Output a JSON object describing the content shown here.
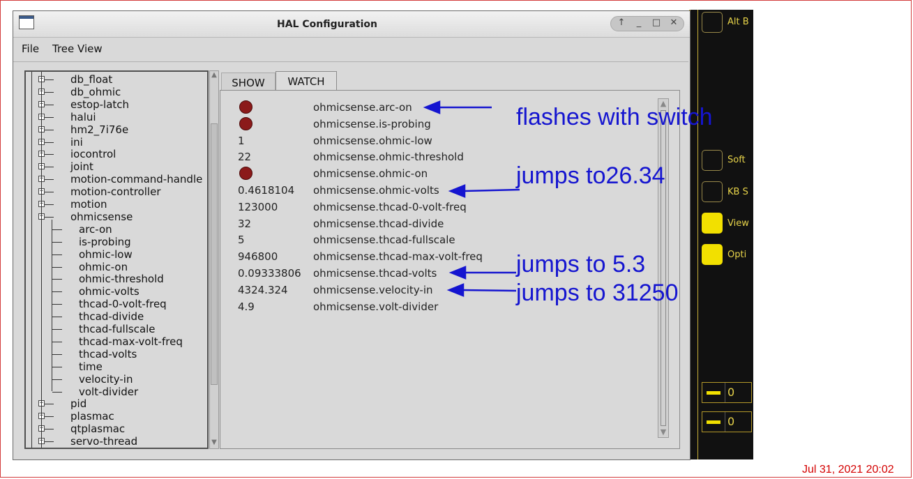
{
  "window": {
    "title": "HAL Configuration",
    "controls": [
      "↑",
      "_",
      "□",
      "✕"
    ]
  },
  "menu": {
    "file": "File",
    "tree_view": "Tree View"
  },
  "tree": {
    "items": [
      {
        "label": "db_float",
        "level": 0,
        "expandable": true
      },
      {
        "label": "db_ohmic",
        "level": 0,
        "expandable": true
      },
      {
        "label": "estop-latch",
        "level": 0,
        "expandable": true
      },
      {
        "label": "halui",
        "level": 0,
        "expandable": true
      },
      {
        "label": "hm2_7i76e",
        "level": 0,
        "expandable": true
      },
      {
        "label": "ini",
        "level": 0,
        "expandable": true
      },
      {
        "label": "iocontrol",
        "level": 0,
        "expandable": true
      },
      {
        "label": "joint",
        "level": 0,
        "expandable": true
      },
      {
        "label": "motion-command-handle",
        "level": 0,
        "expandable": true
      },
      {
        "label": "motion-controller",
        "level": 0,
        "expandable": true
      },
      {
        "label": "motion",
        "level": 0,
        "expandable": true
      },
      {
        "label": "ohmicsense",
        "level": 0,
        "expandable": true,
        "expanded": true
      },
      {
        "label": "arc-on",
        "level": 1
      },
      {
        "label": "is-probing",
        "level": 1
      },
      {
        "label": "ohmic-low",
        "level": 1
      },
      {
        "label": "ohmic-on",
        "level": 1
      },
      {
        "label": "ohmic-threshold",
        "level": 1
      },
      {
        "label": "ohmic-volts",
        "level": 1
      },
      {
        "label": "thcad-0-volt-freq",
        "level": 1
      },
      {
        "label": "thcad-divide",
        "level": 1
      },
      {
        "label": "thcad-fullscale",
        "level": 1
      },
      {
        "label": "thcad-max-volt-freq",
        "level": 1
      },
      {
        "label": "thcad-volts",
        "level": 1
      },
      {
        "label": "time",
        "level": 1
      },
      {
        "label": "velocity-in",
        "level": 1
      },
      {
        "label": "volt-divider",
        "level": 1
      },
      {
        "label": "pid",
        "level": 0,
        "expandable": true
      },
      {
        "label": "plasmac",
        "level": 0,
        "expandable": true
      },
      {
        "label": "qtplasmac",
        "level": 0,
        "expandable": true
      },
      {
        "label": "servo-thread",
        "level": 0,
        "expandable": true
      }
    ]
  },
  "tabs": {
    "show": "SHOW",
    "watch": "WATCH"
  },
  "watch": {
    "rows": [
      {
        "value": "",
        "led": true,
        "name": "ohmicsense.arc-on"
      },
      {
        "value": "",
        "led": true,
        "name": "ohmicsense.is-probing"
      },
      {
        "value": "1",
        "led": false,
        "name": "ohmicsense.ohmic-low"
      },
      {
        "value": "22",
        "led": false,
        "name": "ohmicsense.ohmic-threshold"
      },
      {
        "value": "",
        "led": true,
        "name": "ohmicsense.ohmic-on"
      },
      {
        "value": "0.4618104",
        "led": false,
        "name": "ohmicsense.ohmic-volts"
      },
      {
        "value": "123000",
        "led": false,
        "name": "ohmicsense.thcad-0-volt-freq"
      },
      {
        "value": "32",
        "led": false,
        "name": "ohmicsense.thcad-divide"
      },
      {
        "value": "5",
        "led": false,
        "name": "ohmicsense.thcad-fullscale"
      },
      {
        "value": "946800",
        "led": false,
        "name": "ohmicsense.thcad-max-volt-freq"
      },
      {
        "value": "0.09333806",
        "led": false,
        "name": "ohmicsense.thcad-volts"
      },
      {
        "value": "4324.324",
        "led": false,
        "name": "ohmicsense.velocity-in"
      },
      {
        "value": "4.9",
        "led": false,
        "name": "ohmicsense.volt-divider"
      }
    ]
  },
  "annotations": {
    "flashes": "flashes with switch",
    "ohmic_volts": "jumps to26.34",
    "thcad_volts": "jumps to 5.3",
    "velocity_in": "jumps to 31250"
  },
  "background_app": {
    "buttons": [
      {
        "label": "Alt B",
        "on": false
      },
      {
        "label": "Soft",
        "on": false
      },
      {
        "label": "KB S",
        "on": false
      },
      {
        "label": "View",
        "on": true
      },
      {
        "label": "Opti",
        "on": true
      }
    ],
    "readouts": [
      "0",
      "0"
    ]
  },
  "timestamp": "Jul 31, 2021 20:02",
  "colors": {
    "annotation": "#1515d0",
    "led_on": "#8b1a1a",
    "timestamp": "#d40000",
    "accent_yellow": "#f2e000"
  }
}
